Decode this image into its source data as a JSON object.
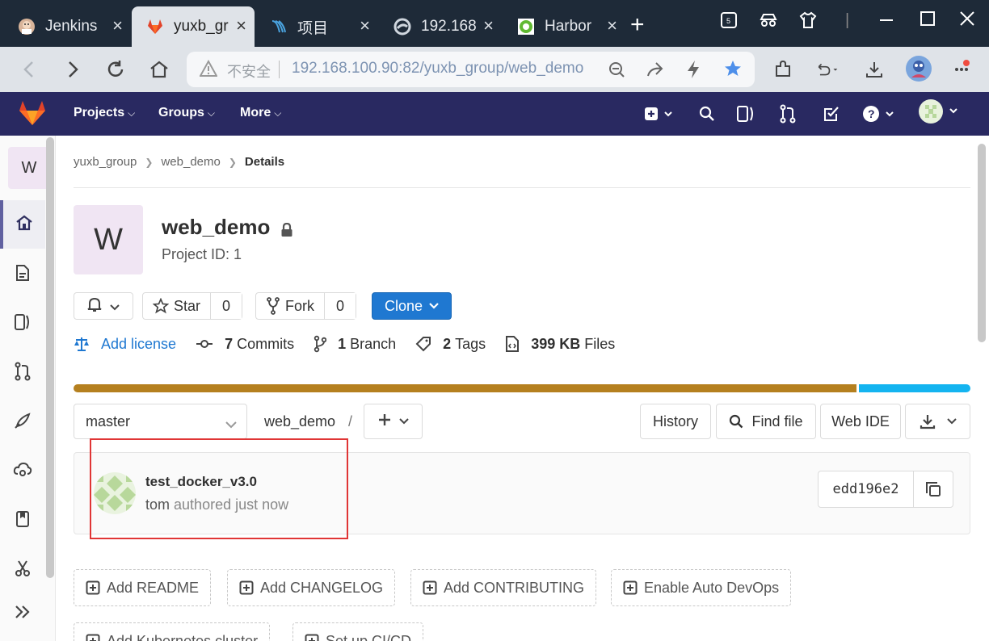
{
  "browser": {
    "tabs": [
      {
        "label": "Jenkins"
      },
      {
        "label": "yuxb_gr"
      },
      {
        "label": "项目"
      },
      {
        "label": "192.168"
      },
      {
        "label": "Harbor"
      }
    ],
    "new_tab": "+",
    "address": {
      "insecure_label": "不安全",
      "url": "192.168.100.90:82/yuxb_group/web_demo"
    }
  },
  "gitlab": {
    "nav": {
      "projects": "Projects",
      "groups": "Groups",
      "more": "More"
    },
    "sidebar": {
      "project_initial": "W"
    },
    "breadcrumb": {
      "group": "yuxb_group",
      "project": "web_demo",
      "current": "Details"
    },
    "project": {
      "initial": "W",
      "name": "web_demo",
      "id_label": "Project ID: 1"
    },
    "actions": {
      "star_label": "Star",
      "star_count": "0",
      "fork_label": "Fork",
      "fork_count": "0",
      "clone_label": "Clone"
    },
    "stats": {
      "license": "Add license",
      "commits_count": "7",
      "commits_label": "Commits",
      "branches_count": "1",
      "branches_label": "Branch",
      "tags_count": "2",
      "tags_label": "Tags",
      "files_size": "399 KB",
      "files_label": "Files"
    },
    "languages": [
      {
        "color": "#b5801f",
        "fraction": 0.875
      },
      {
        "color": "#14b4f0",
        "fraction": 0.125
      }
    ],
    "repo": {
      "branch": "master",
      "path": "web_demo",
      "path_sep": "/",
      "history": "History",
      "find_file": "Find file",
      "web_ide": "Web IDE"
    },
    "commit": {
      "title": "test_docker_v3.0",
      "author": "tom",
      "meta": "authored just now",
      "sha": "edd196e2"
    },
    "quick_actions": [
      {
        "label": "Add README"
      },
      {
        "label": "Add CHANGELOG"
      },
      {
        "label": "Add CONTRIBUTING"
      },
      {
        "label": "Enable Auto DevOps"
      },
      {
        "label": "Add Kubernetes cluster"
      },
      {
        "label": "Set up CI/CD"
      }
    ]
  }
}
